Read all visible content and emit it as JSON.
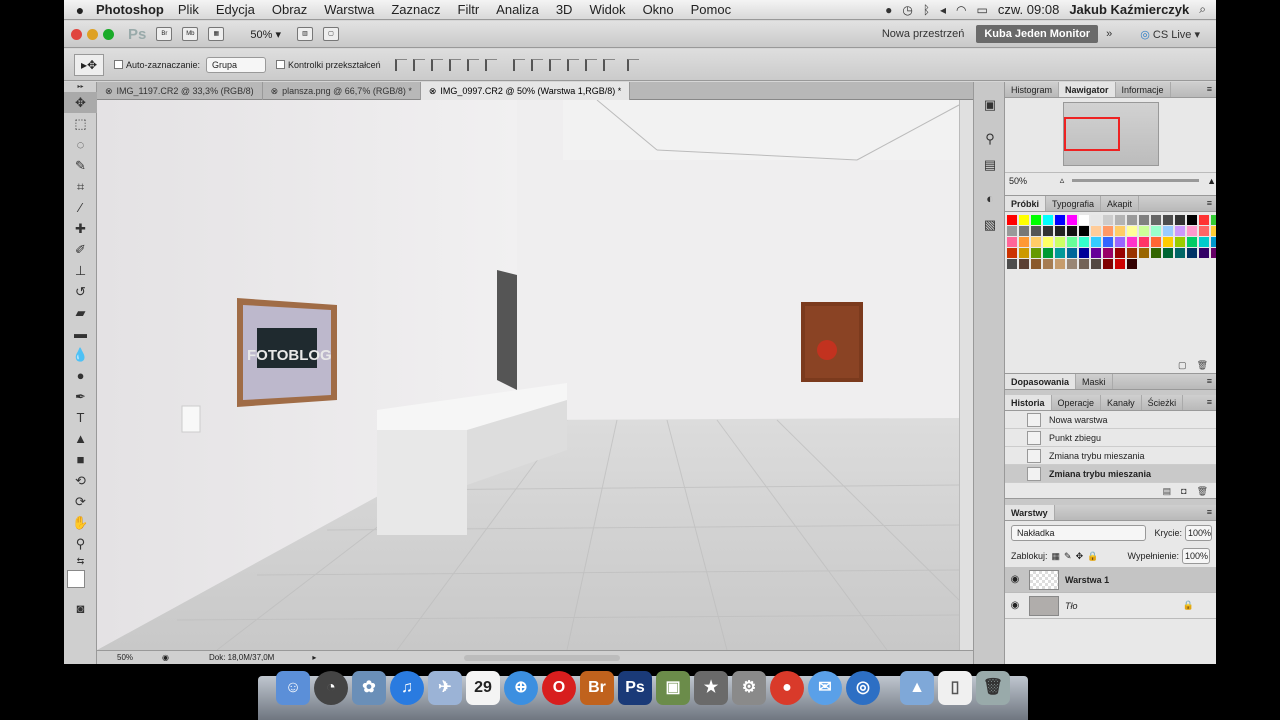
{
  "menubar": {
    "app_name": "Photoshop",
    "menus": [
      "Plik",
      "Edycja",
      "Obraz",
      "Warstwa",
      "Zaznacz",
      "Filtr",
      "Analiza",
      "3D",
      "Widok",
      "Okno",
      "Pomoc"
    ],
    "clock": "czw. 09:08",
    "user": "Jakub Kaźmierczyk"
  },
  "appbar": {
    "logo": "Ps",
    "btn_bridge": "Br",
    "btn_mini": "Mb",
    "zoom": "50%",
    "workspace_new": "Nowa przestrzeń",
    "workspace_active": "Kuba Jeden Monitor",
    "more": "»",
    "cslive": "CS Live"
  },
  "options": {
    "auto_select_label": "Auto-zaznaczanie:",
    "auto_select_value": "Grupa",
    "transform_label": "Kontrolki przekształceń"
  },
  "doc_tabs": [
    {
      "label": "IMG_1197.CR2 @ 33,3% (RGB/8)"
    },
    {
      "label": "plansza.png @ 66,7% (RGB/8) *"
    },
    {
      "label": "IMG_0997.CR2 @ 50% (Warstwa 1,RGB/8) *"
    }
  ],
  "canvas": {
    "watermark": "FOTOBLOG"
  },
  "status": {
    "zoom": "50%",
    "doc": "Dok: 18,0M/37,0M"
  },
  "navigator": {
    "tabs": [
      "Histogram",
      "Nawigator",
      "Informacje"
    ],
    "zoom": "50%"
  },
  "swatches_panel": {
    "tabs": [
      "Próbki",
      "Typografia",
      "Akapit"
    ],
    "colors": [
      "#ff0000",
      "#ffff00",
      "#00ff00",
      "#00ffff",
      "#0000ff",
      "#ff00ff",
      "#ffffff",
      "#e6e6e6",
      "#cccccc",
      "#b3b3b3",
      "#999999",
      "#808080",
      "#666666",
      "#4d4d4d",
      "#333333",
      "#000000",
      "#ff3333",
      "#33cc33",
      "#3399ff",
      "#ff66cc",
      "#ffcc00",
      "#663399",
      "#999999",
      "#777777",
      "#555555",
      "#333333",
      "#222222",
      "#111111",
      "#000000",
      "#ffcc99",
      "#ff9966",
      "#ffcc66",
      "#ffff99",
      "#ccff99",
      "#99ffcc",
      "#99ccff",
      "#cc99ff",
      "#ff99cc",
      "#ff6666",
      "#ffcc33",
      "#99ff66",
      "#66ffff",
      "#6699ff",
      "#cc66ff",
      "#ff6699",
      "#ff9933",
      "#ffcc66",
      "#ffff66",
      "#ccff66",
      "#66ff99",
      "#33ffcc",
      "#33ccff",
      "#3366ff",
      "#9966ff",
      "#ff33cc",
      "#ff3366",
      "#ff6633",
      "#ffcc00",
      "#99cc00",
      "#00cc66",
      "#00cccc",
      "#0099cc",
      "#3333cc",
      "#9933cc",
      "#cc3399",
      "#cc0033",
      "#cc3300",
      "#cc9900",
      "#669900",
      "#009933",
      "#009999",
      "#006699",
      "#000099",
      "#660099",
      "#990066",
      "#990000",
      "#993300",
      "#996600",
      "#336600",
      "#006633",
      "#006666",
      "#003366",
      "#330066",
      "#660066",
      "#660033",
      "#663300",
      "#333300",
      "#003300",
      "#4d4d4d",
      "#5c4033",
      "#8b5a2b",
      "#a67c52",
      "#c69c6d",
      "#998675",
      "#736357",
      "#534741",
      "#800000",
      "#cc0000",
      "#330000"
    ]
  },
  "adjust_panel": {
    "tabs": [
      "Dopasowania",
      "Maski"
    ]
  },
  "history_panel": {
    "tabs": [
      "Historia",
      "Operacje",
      "Kanały",
      "Ścieżki"
    ],
    "items": [
      "Nowa warstwa",
      "Punkt zbiegu",
      "Zmiana trybu mieszania",
      "Zmiana trybu mieszania"
    ]
  },
  "layers_panel": {
    "tab": "Warstwy",
    "blend_mode": "Nakładka",
    "opacity_label": "Krycie:",
    "opacity": "100%",
    "lock_label": "Zablokuj:",
    "fill_label": "Wypełnienie:",
    "fill": "100%",
    "layers": [
      "Warstwa 1",
      "Tło"
    ]
  },
  "dock": {
    "calendar_day": "29"
  }
}
